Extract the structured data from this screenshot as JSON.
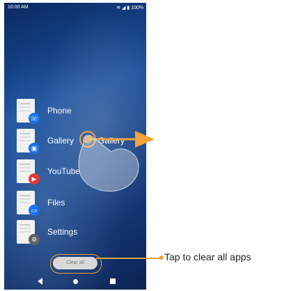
{
  "statusbar": {
    "time": "10:00 AM",
    "battery": "100%"
  },
  "recents": [
    {
      "label": "Phone",
      "badge_color": "#1a73e8"
    },
    {
      "label": "Gallery",
      "badge_color": "#1a73e8"
    },
    {
      "label": "YouTube",
      "badge_color": "#e53935"
    },
    {
      "label": "Files",
      "badge_color": "#1a73e8"
    },
    {
      "label": "Settings",
      "badge_color": "#5f6368"
    }
  ],
  "gallery_drag_label": "Gallery",
  "clear_all": "Clear all",
  "callout": "Tap to clear all apps",
  "accent_color": "#f0a33a"
}
